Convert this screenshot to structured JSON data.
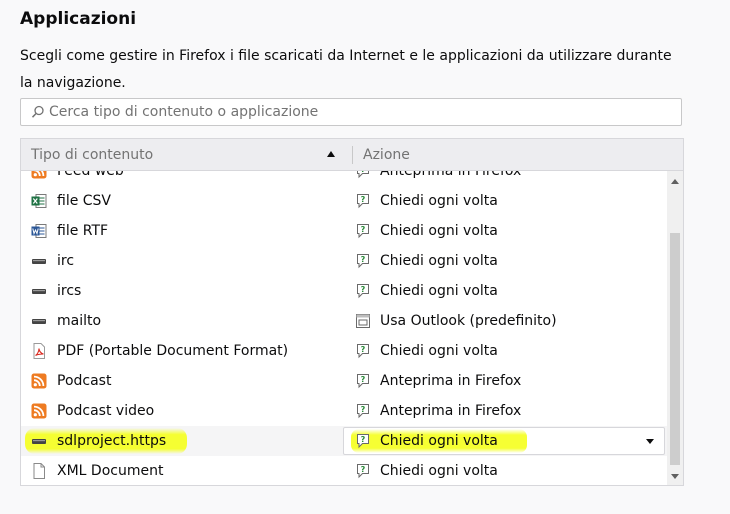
{
  "section": {
    "title": "Applicazioni",
    "description": "Scegli come gestire in Firefox i file scaricati da Internet e le applicazioni da utilizzare durante la navigazione."
  },
  "search": {
    "placeholder": "Cerca tipo di contenuto o applicazione",
    "value": ""
  },
  "table": {
    "columns": [
      "Tipo di contenuto",
      "Azione"
    ],
    "sort": "ascending",
    "rows": [
      {
        "type": "Feed web",
        "type_icon": "rss-icon",
        "action": "Anteprima in Firefox",
        "action_icon": "ask-icon"
      },
      {
        "type": "file CSV",
        "type_icon": "excel-icon",
        "action": "Chiedi ogni volta",
        "action_icon": "ask-icon"
      },
      {
        "type": "file RTF",
        "type_icon": "word-icon",
        "action": "Chiedi ogni volta",
        "action_icon": "ask-icon"
      },
      {
        "type": "irc",
        "type_icon": "protocol-icon",
        "action": "Chiedi ogni volta",
        "action_icon": "ask-icon"
      },
      {
        "type": "ircs",
        "type_icon": "protocol-icon",
        "action": "Chiedi ogni volta",
        "action_icon": "ask-icon"
      },
      {
        "type": "mailto",
        "type_icon": "protocol-icon",
        "action": "Usa Outlook (predefinito)",
        "action_icon": "app-icon"
      },
      {
        "type": "PDF (Portable Document Format)",
        "type_icon": "pdf-icon",
        "action": "Chiedi ogni volta",
        "action_icon": "ask-icon"
      },
      {
        "type": "Podcast",
        "type_icon": "rss-icon",
        "action": "Anteprima in Firefox",
        "action_icon": "ask-icon"
      },
      {
        "type": "Podcast video",
        "type_icon": "rss-icon",
        "action": "Anteprima in Firefox",
        "action_icon": "ask-icon"
      },
      {
        "type": "sdlproject.https",
        "type_icon": "protocol-icon",
        "action": "Chiedi ogni volta",
        "action_icon": "ask-icon",
        "selected": true
      },
      {
        "type": "XML Document",
        "type_icon": "file-icon",
        "action": "Chiedi ogni volta",
        "action_icon": "ask-icon"
      }
    ]
  },
  "colors": {
    "highlight": "#f5ff28",
    "accent_orange": "#ee7b22",
    "excel_green": "#1f7244",
    "word_blue": "#2b5797",
    "pdf_red": "#d9261c"
  }
}
